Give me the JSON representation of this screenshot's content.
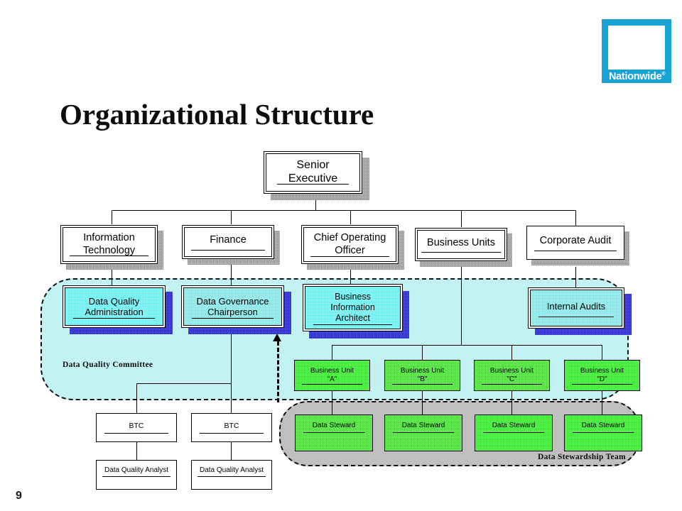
{
  "slide": {
    "title": "Organizational Structure",
    "page_number": "9"
  },
  "logo": {
    "wordmark": "Nationwide",
    "registered_mark": "®",
    "brand_color": "#19a3d4"
  },
  "colors": {
    "committee_region_fill": "#c3f2f2",
    "stewardship_region_fill": "#bfbfbf",
    "executive_box_fill": "#4fe6ea",
    "business_unit_fill": "#22dd22",
    "plain_box_fill": "#ffffff",
    "shadow_gray": "#9a9a9a",
    "shadow_blue": "#1414b4"
  },
  "chart_data": {
    "type": "diagram",
    "title": "Organizational Structure",
    "nodes": [
      {
        "id": "senior-executive",
        "label": "Senior\nExecutive",
        "level": 1,
        "style": "white"
      },
      {
        "id": "information-technology",
        "label": "Information\nTechnology",
        "level": 2,
        "style": "white"
      },
      {
        "id": "finance",
        "label": "Finance",
        "level": 2,
        "style": "white"
      },
      {
        "id": "chief-operating-officer",
        "label": "Chief Operating\nOfficer",
        "level": 2,
        "style": "white"
      },
      {
        "id": "business-units",
        "label": "Business Units",
        "level": 2,
        "style": "white"
      },
      {
        "id": "corporate-audit",
        "label": "Corporate Audit",
        "level": 2,
        "style": "white"
      },
      {
        "id": "data-quality-administration",
        "label": "Data Quality\nAdministration",
        "level": 3,
        "style": "cyan"
      },
      {
        "id": "data-governance-chairperson",
        "label": "Data Governance\nChairperson",
        "level": 3,
        "style": "cyan"
      },
      {
        "id": "business-information-architect",
        "label": "Business\nInformation\nArchitect",
        "level": 3,
        "style": "cyan"
      },
      {
        "id": "internal-audits",
        "label": "Internal Audits",
        "level": 3,
        "style": "cyan"
      },
      {
        "id": "business-unit-a",
        "label": "Business Unit\n\"A\"",
        "level": 4,
        "style": "green"
      },
      {
        "id": "business-unit-b",
        "label": "Business Unit\n\"B\"",
        "level": 4,
        "style": "green"
      },
      {
        "id": "business-unit-c",
        "label": "Business Unit\n\"C\"",
        "level": 4,
        "style": "green"
      },
      {
        "id": "business-unit-d",
        "label": "Business Unit\n\"D\"",
        "level": 4,
        "style": "green"
      },
      {
        "id": "data-steward-a",
        "label": "Data Steward",
        "level": 5,
        "style": "green"
      },
      {
        "id": "data-steward-b",
        "label": "Data Steward",
        "level": 5,
        "style": "green"
      },
      {
        "id": "data-steward-c",
        "label": "Data Steward",
        "level": 5,
        "style": "green"
      },
      {
        "id": "data-steward-d",
        "label": "Data Steward",
        "level": 5,
        "style": "green"
      },
      {
        "id": "btc-1",
        "label": "BTC",
        "level": 4,
        "style": "white"
      },
      {
        "id": "btc-2",
        "label": "BTC",
        "level": 4,
        "style": "white"
      },
      {
        "id": "data-quality-analyst-1",
        "label": "Data Quality Analyst",
        "level": 5,
        "style": "white"
      },
      {
        "id": "data-quality-analyst-2",
        "label": "Data Quality Analyst",
        "level": 5,
        "style": "white"
      }
    ],
    "groups": [
      {
        "id": "data-quality-committee",
        "label": "Data Quality Committee",
        "fill": "#c3f2f2"
      },
      {
        "id": "data-stewardship-team",
        "label": "Data Stewardship Team",
        "fill": "#bfbfbf"
      }
    ],
    "edges": [
      {
        "from": "senior-executive",
        "to": "information-technology"
      },
      {
        "from": "senior-executive",
        "to": "finance"
      },
      {
        "from": "senior-executive",
        "to": "chief-operating-officer"
      },
      {
        "from": "senior-executive",
        "to": "business-units"
      },
      {
        "from": "senior-executive",
        "to": "corporate-audit"
      },
      {
        "from": "information-technology",
        "to": "data-quality-administration"
      },
      {
        "from": "finance",
        "to": "data-governance-chairperson"
      },
      {
        "from": "chief-operating-officer",
        "to": "business-information-architect"
      },
      {
        "from": "corporate-audit",
        "to": "internal-audits"
      },
      {
        "from": "business-units",
        "to": "business-unit-a"
      },
      {
        "from": "business-units",
        "to": "business-unit-b"
      },
      {
        "from": "business-units",
        "to": "business-unit-c"
      },
      {
        "from": "business-units",
        "to": "business-unit-d"
      },
      {
        "from": "business-unit-a",
        "to": "data-steward-a"
      },
      {
        "from": "business-unit-b",
        "to": "data-steward-b"
      },
      {
        "from": "business-unit-c",
        "to": "data-steward-c"
      },
      {
        "from": "business-unit-d",
        "to": "data-steward-d"
      },
      {
        "from": "finance",
        "to": "btc-1"
      },
      {
        "from": "finance",
        "to": "btc-2"
      },
      {
        "from": "btc-1",
        "to": "data-quality-analyst-1"
      },
      {
        "from": "btc-2",
        "to": "data-quality-analyst-2"
      },
      {
        "from": "data-stewardship-team",
        "to": "business-information-architect",
        "style": "dashed-arrow"
      }
    ]
  },
  "boxes": {
    "senior_executive": "Senior\nExecutive",
    "information_technology": "Information\nTechnology",
    "finance": "Finance",
    "chief_operating_officer": "Chief Operating\nOfficer",
    "business_units": "Business Units",
    "corporate_audit": "Corporate Audit",
    "data_quality_administration": "Data Quality\nAdministration",
    "data_governance_chairperson": "Data Governance\nChairperson",
    "business_information_architect": "Business\nInformation\nArchitect",
    "internal_audits": "Internal Audits",
    "business_unit_a": "Business Unit\n\"A\"",
    "business_unit_b": "Business Unit\n\"B\"",
    "business_unit_c": "Business Unit\n\"C\"",
    "business_unit_d": "Business Unit\n\"D\"",
    "data_steward_a": "Data Steward",
    "data_steward_b": "Data Steward",
    "data_steward_c": "Data Steward",
    "data_steward_d": "Data Steward",
    "btc_1": "BTC",
    "btc_2": "BTC",
    "data_quality_analyst_1": "Data Quality Analyst",
    "data_quality_analyst_2": "Data Quality Analyst"
  },
  "regions": {
    "data_quality_committee": "Data Quality Committee",
    "data_stewardship_team": "Data Stewardship Team"
  }
}
